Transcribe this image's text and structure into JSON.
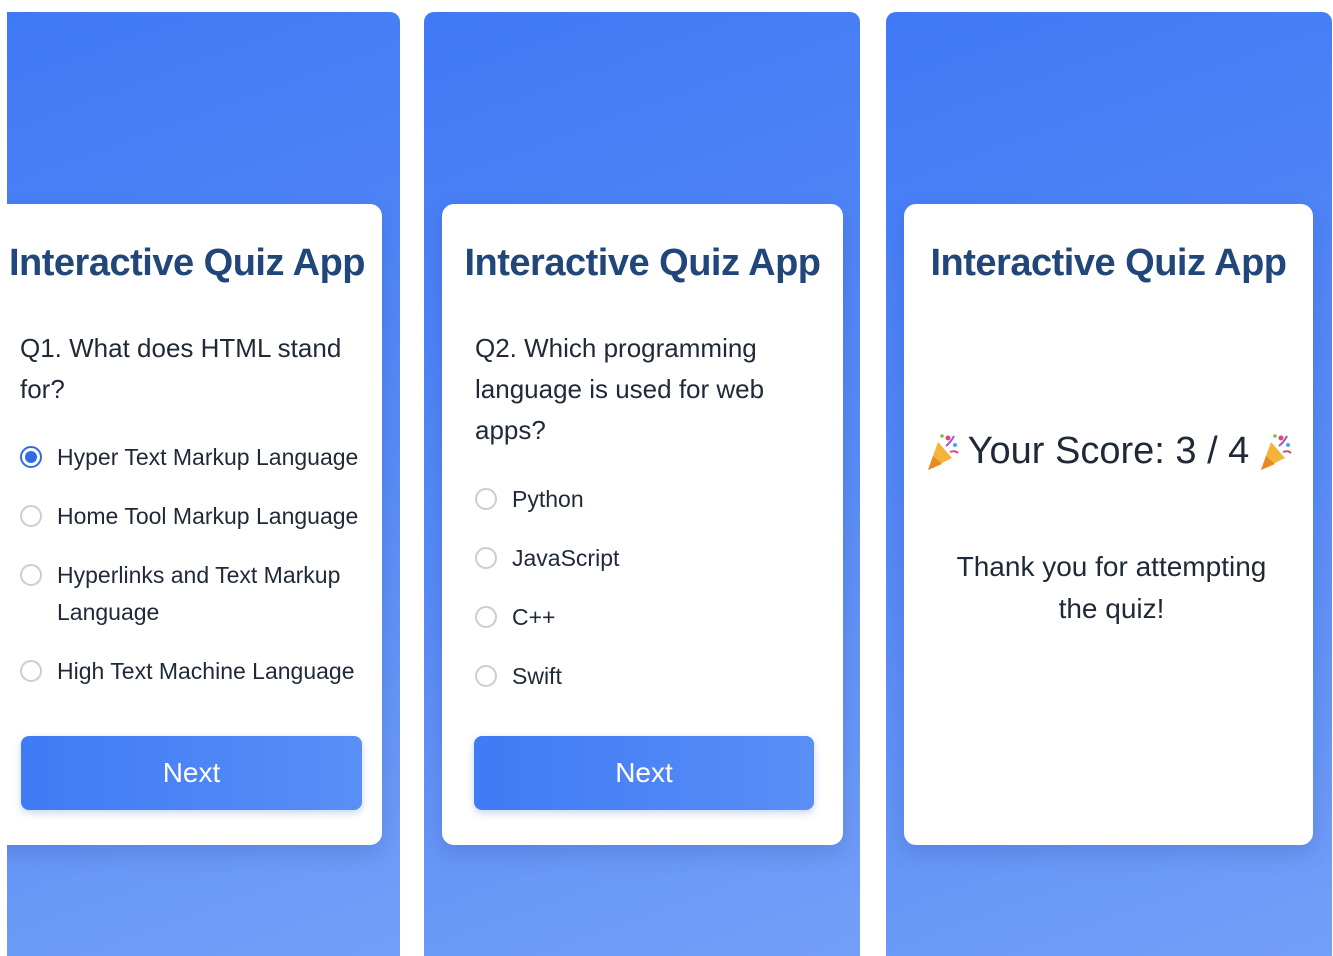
{
  "screens": [
    {
      "title": "Interactive Quiz App",
      "question": "Q1. What does HTML stand for?",
      "options": [
        "Hyper Text Markup Language",
        "Home Tool Markup Language",
        "Hyperlinks and Text Markup Language",
        "High Text Machine Language"
      ],
      "selected_option": "Hyper Text Markup Language",
      "next_label": "Next"
    },
    {
      "title": "Interactive Quiz App",
      "question": "Q2. Which programming language is used for web apps?",
      "options": [
        "Python",
        "JavaScript",
        "C++",
        "Swift"
      ],
      "selected_option": null,
      "next_label": "Next"
    },
    {
      "title": "Interactive Quiz App",
      "score_text": "Your Score: 3 / 4",
      "score_icon": "party-popper-icon",
      "thanks": "Thank you for attempting the quiz!"
    }
  ],
  "colors": {
    "background_gradient_start": "#4079f6",
    "background_gradient_end": "#74a0f8",
    "title": "#21467a",
    "button": "#3f7bf5",
    "radio_selected": "#2f6ae8"
  }
}
